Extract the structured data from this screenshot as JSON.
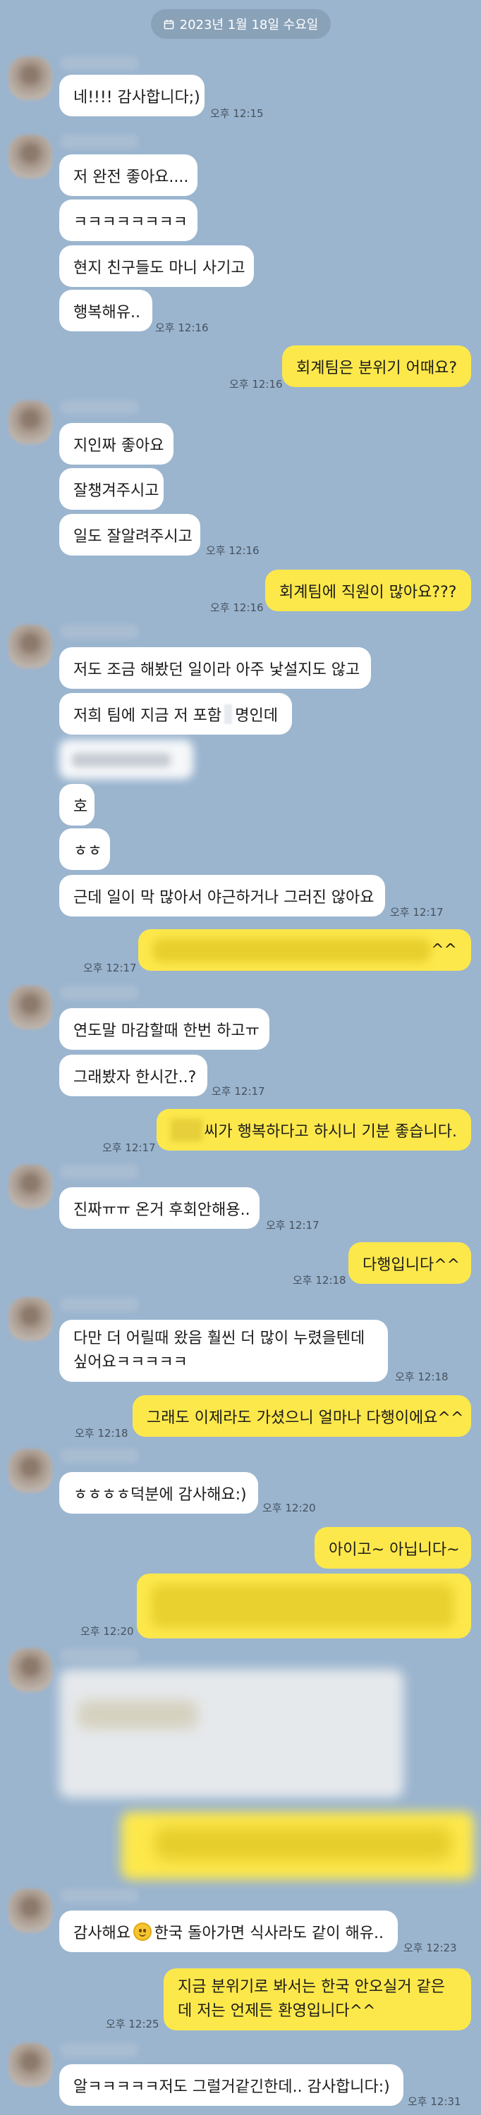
{
  "date_divider": {
    "icon": "calendar-icon",
    "text": "2023년 1월 18일 수요일"
  },
  "colors": {
    "background": "#9bb5cf",
    "incoming_bubble": "#ffffff",
    "outgoing_bubble": "#fde84b"
  },
  "messages": {
    "m1": {
      "text": "네!!!! 감사합니다;)",
      "time": "오후 12:15"
    },
    "m2": {
      "text": "저 완전 좋아요...."
    },
    "m3": {
      "text": "ㅋㅋㅋㅋㅋㅋㅋㅋ"
    },
    "m4": {
      "text": "현지 친구들도 마니 사기고"
    },
    "m5": {
      "text": "행복해유..",
      "time": "오후 12:16"
    },
    "m6": {
      "text": "회계팀은 분위기 어때요?",
      "time": "오후 12:16"
    },
    "m7": {
      "text": "지인짜 좋아요"
    },
    "m8": {
      "text": "잘챙겨주시고"
    },
    "m9": {
      "text": "일도 잘알려주시고",
      "time": "오후 12:16"
    },
    "m10": {
      "text": "회계팀에 직원이 많아요???",
      "time": "오후 12:16"
    },
    "m11": {
      "text": "저도 조금 해봤던 일이라 아주 낯설지도 않고"
    },
    "m12": {
      "text_before": "저희 팀에 지금 저 포함",
      "text_after": "명인데"
    },
    "m14": {
      "text": "호"
    },
    "m15": {
      "text": "ㅎㅎ"
    },
    "m16": {
      "text": "근데 일이 막 많아서 야근하거나 그러진 않아요",
      "time": "오후 12:17"
    },
    "m17": {
      "text": "^^",
      "time": "오후 12:17"
    },
    "m18": {
      "text": "연도말 마감할때 한번 하고ㅠ"
    },
    "m19": {
      "text": "그래봤자 한시간..?",
      "time": "오후 12:17"
    },
    "m20": {
      "text": "씨가 행복하다고 하시니 기분 좋습니다.",
      "time": "오후 12:17"
    },
    "m21": {
      "text": "진짜ㅠㅠ 온거 후회안해용..",
      "time": "오후 12:17"
    },
    "m22": {
      "text": "다행입니다^^",
      "time": "오후 12:18"
    },
    "m23": {
      "text": "다만 더 어릴때 왔음 훨씬 더 많이 누렸을텐데싶어요ㅋㅋㅋㅋㅋ",
      "time": "오후 12:18"
    },
    "m24": {
      "text": "그래도 이제라도 가셨으니 얼마나 다행이에요^^",
      "time": "오후 12:18"
    },
    "m25": {
      "text": "ㅎㅎㅎㅎ덕분에 감사해요:)",
      "time": "오후 12:20"
    },
    "m26": {
      "text": "아이고~ 아닙니다~"
    },
    "m27": {
      "time": "오후 12:20"
    },
    "m29": {
      "text_before": "감사해요",
      "text_after": "한국 돌아가면 식사라도 같이 해유..",
      "time": "오후 12:23"
    },
    "m30": {
      "text": "지금 분위기로 봐서는 한국 안오실거 같은데 저는 언제든 환영입니다^^",
      "time": "오후 12:25"
    },
    "m31": {
      "text": "알ㅋㅋㅋㅋㅋ저도 그럴거같긴한데.. 감사합니다:)",
      "time": "오후 12:31"
    }
  }
}
